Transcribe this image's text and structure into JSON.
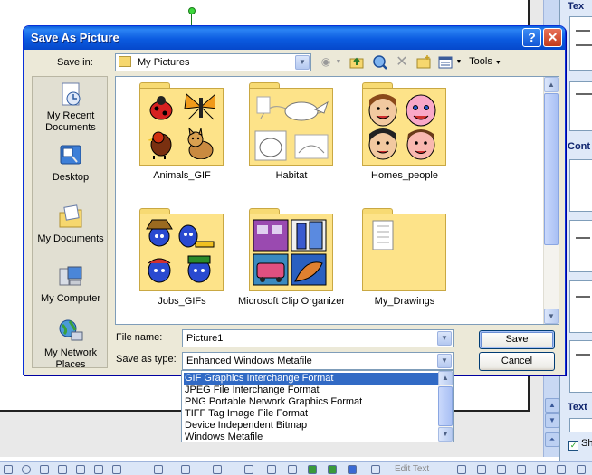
{
  "dialog": {
    "title": "Save As Picture",
    "help_icon": "question-mark-icon",
    "close_icon": "close-x-icon"
  },
  "look_in": {
    "label": "Save in:",
    "value": "My Pictures",
    "icon": "folder-icon"
  },
  "toolbar": {
    "back_icon": "back-arrow-icon",
    "up_icon": "up-folder-icon",
    "search_icon": "search-web-icon",
    "delete_icon": "delete-x-icon",
    "new_folder_icon": "new-folder-icon",
    "views_icon": "views-icon",
    "tools_label": "Tools"
  },
  "places": [
    {
      "label": "My Recent Documents",
      "icon": "recent-documents-icon"
    },
    {
      "label": "Desktop",
      "icon": "desktop-icon"
    },
    {
      "label": "My Documents",
      "icon": "my-documents-icon"
    },
    {
      "label": "My Computer",
      "icon": "computer-icon"
    },
    {
      "label": "My Network Places",
      "icon": "network-places-icon"
    }
  ],
  "folders": [
    {
      "name": "Animals_GIF"
    },
    {
      "name": "Habitat"
    },
    {
      "name": "Homes_people"
    },
    {
      "name": "Jobs_GIFs"
    },
    {
      "name": "Microsoft Clip Organizer"
    },
    {
      "name": "My_Drawings"
    }
  ],
  "file_name": {
    "label": "File name:",
    "value": "Picture1"
  },
  "save_as_type": {
    "label": "Save as type:",
    "value": "Enhanced Windows Metafile",
    "options": [
      "GIF Graphics Interchange Format",
      "JPEG File Interchange Format",
      "PNG Portable Network Graphics Format",
      "TIFF Tag Image File Format",
      "Device Independent Bitmap",
      "Windows Metafile"
    ],
    "highlighted": "GIF Graphics Interchange Format"
  },
  "buttons": {
    "save": "Save",
    "cancel": "Cancel"
  },
  "task_pane": {
    "heading_top": "Tex",
    "heading_mid": "Cont",
    "heading_bottom": "Text",
    "checkbox_label": "Show"
  },
  "bottom_toolbar": {
    "edit_text_label": "Edit Text"
  },
  "colors": {
    "title_bar": "#0b5be0",
    "dialog_bg": "#ece9d8",
    "selection": "#316ac5",
    "folder": "#fde389"
  }
}
